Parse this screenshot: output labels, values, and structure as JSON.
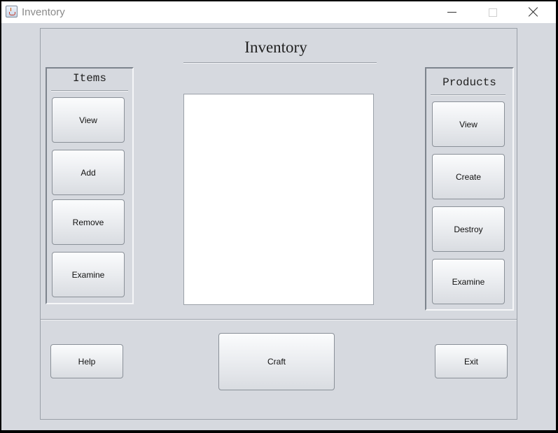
{
  "window": {
    "title": "Inventory"
  },
  "heading": "Inventory",
  "items_panel": {
    "title": "Items",
    "buttons": [
      "View",
      "Add",
      "Remove",
      "Examine"
    ]
  },
  "products_panel": {
    "title": "Products",
    "buttons": [
      "View",
      "Create",
      "Destroy",
      "Examine"
    ]
  },
  "footer": {
    "help_label": "Help",
    "craft_label": "Craft",
    "exit_label": "Exit"
  }
}
